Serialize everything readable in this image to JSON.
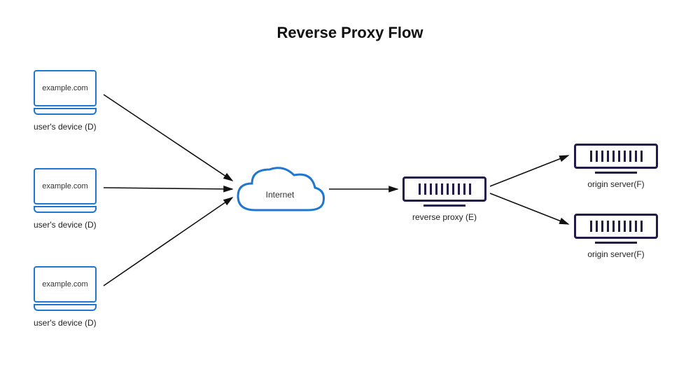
{
  "title": "Reverse Proxy Flow",
  "devices": {
    "url_label": "example.com",
    "caption": "user's device (D)"
  },
  "cloud": {
    "label": "Internet"
  },
  "proxy": {
    "caption": "reverse proxy (E)"
  },
  "server": {
    "caption": "origin server(F)"
  }
}
